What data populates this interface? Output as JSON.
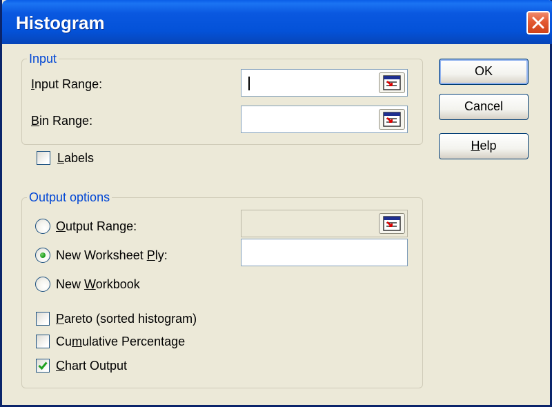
{
  "window": {
    "title": "Histogram"
  },
  "input_group": {
    "title": "Input",
    "input_range": {
      "label_accel": "I",
      "label_rest": "nput Range:",
      "value": ""
    },
    "bin_range": {
      "label_accel": "B",
      "label_rest": "in Range:",
      "value": ""
    }
  },
  "labels_checkbox": {
    "label_accel": "L",
    "label_rest": "abels",
    "checked": false
  },
  "output_group": {
    "title": "Output options",
    "output_range": {
      "label_accel": "O",
      "label_rest": "utput Range:",
      "selected": false,
      "value": ""
    },
    "new_worksheet": {
      "label_pre": "New Worksheet ",
      "label_accel": "P",
      "label_rest": "ly:",
      "selected": true,
      "value": ""
    },
    "new_workbook": {
      "label_pre": "New ",
      "label_accel": "W",
      "label_rest": "orkbook",
      "selected": false
    },
    "pareto": {
      "label_pre": "",
      "label_accel": "P",
      "label_rest": "areto (sorted histogram)",
      "checked": false
    },
    "cumulative": {
      "label_pre": "Cu",
      "label_accel": "m",
      "label_rest": "ulative Percentage",
      "checked": false
    },
    "chart_output": {
      "label_pre": "",
      "label_accel": "C",
      "label_rest": "hart Output",
      "checked": true
    }
  },
  "buttons": {
    "ok": "OK",
    "cancel": "Cancel",
    "help_accel": "H",
    "help_rest": "elp"
  },
  "colors": {
    "titlebar": "#0452d8",
    "group_title": "#0046d5",
    "check_green": "#21a121",
    "close_red": "#e35a32"
  }
}
